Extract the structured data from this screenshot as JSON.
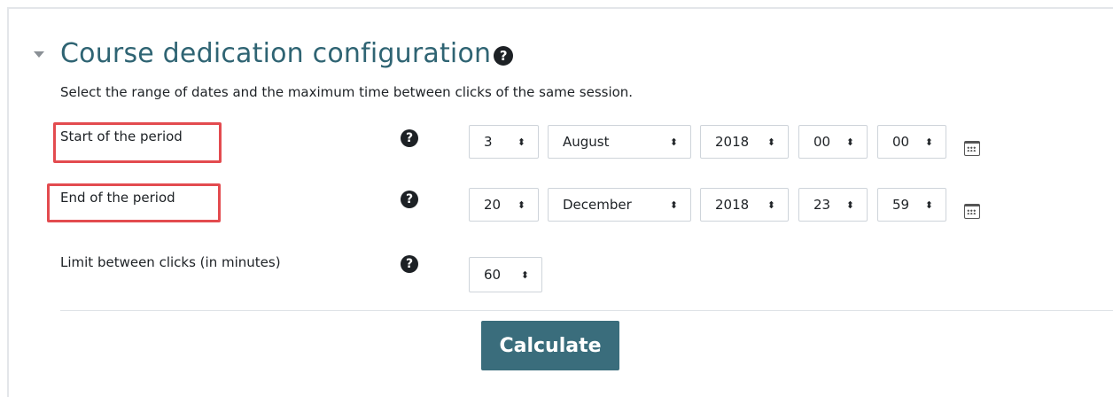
{
  "section": {
    "title": "Course dedication configuration",
    "description": "Select the range of dates and the maximum time between clicks of the same session."
  },
  "start": {
    "label": "Start of the period",
    "day": "3",
    "month": "August",
    "year": "2018",
    "hour": "00",
    "minute": "00"
  },
  "end": {
    "label": "End of the period",
    "day": "20",
    "month": "December",
    "year": "2018",
    "hour": "23",
    "minute": "59"
  },
  "limit": {
    "label": "Limit between clicks (in minutes)",
    "value": "60"
  },
  "help_glyph": "?",
  "select_arrows": "⬍",
  "calculate_label": "Calculate",
  "colors": {
    "title": "#2f6473",
    "button": "#3a6d7c",
    "highlight": "#e34b4f"
  }
}
